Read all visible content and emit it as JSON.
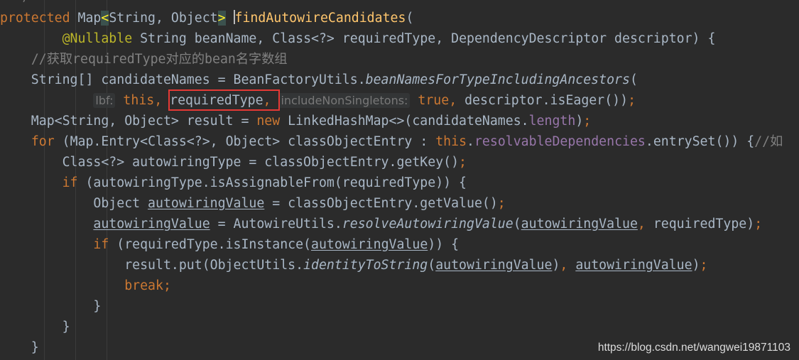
{
  "editor": {
    "top_fragment": "*/",
    "lines": [
      [
        {
          "t": "protected ",
          "c": "kw"
        },
        {
          "t": "Map",
          "c": ""
        },
        {
          "t": "<",
          "c": "brace-hl"
        },
        {
          "t": "String, Object",
          "c": ""
        },
        {
          "t": ">",
          "c": "brace-hl"
        },
        {
          "t": " ",
          "c": ""
        },
        {
          "t": "",
          "c": "caret"
        },
        {
          "t": "findAutowireCandidates",
          "c": "fn"
        },
        {
          "t": "(",
          "c": ""
        }
      ],
      [
        {
          "t": "        ",
          "c": ""
        },
        {
          "t": "@Nullable",
          "c": "ann"
        },
        {
          "t": " String beanName, Class<?> requiredType, DependencyDescriptor descriptor) {",
          "c": ""
        }
      ],
      [
        {
          "t": "    ",
          "c": ""
        },
        {
          "t": "//获取requiredType对应的bean名字数组",
          "c": "cmt"
        }
      ],
      [
        {
          "t": "    String[] candidateNames = BeanFactoryUtils.",
          "c": ""
        },
        {
          "t": "beanNamesForTypeIncludingAncestors",
          "c": "it"
        },
        {
          "t": "(",
          "c": ""
        }
      ],
      [
        {
          "t": "            ",
          "c": ""
        },
        {
          "t": "lbf:",
          "c": "hint"
        },
        {
          "t": " ",
          "c": ""
        },
        {
          "t": "this",
          "c": "kw"
        },
        {
          "t": ", ",
          "c": "kw"
        },
        {
          "t": "requiredType",
          "c": ""
        },
        {
          "t": ", ",
          "c": "kw"
        },
        {
          "t": "includeNonSingletons:",
          "c": "hint"
        },
        {
          "t": " ",
          "c": ""
        },
        {
          "t": "true",
          "c": "kw"
        },
        {
          "t": ", ",
          "c": "kw"
        },
        {
          "t": "descriptor.isEager())",
          "c": ""
        },
        {
          "t": ";",
          "c": "kw"
        }
      ],
      [
        {
          "t": "    Map<String, Object> result = ",
          "c": ""
        },
        {
          "t": "new ",
          "c": "kw"
        },
        {
          "t": "LinkedHashMap<>(candidateNames.",
          "c": ""
        },
        {
          "t": "length",
          "c": "fld"
        },
        {
          "t": ")",
          "c": ""
        },
        {
          "t": ";",
          "c": "kw"
        }
      ],
      [
        {
          "t": "    ",
          "c": ""
        },
        {
          "t": "for ",
          "c": "kw"
        },
        {
          "t": "(Map.Entry<Class<?>, Object> classObjectEntry : ",
          "c": ""
        },
        {
          "t": "this",
          "c": "kw"
        },
        {
          "t": ".",
          "c": ""
        },
        {
          "t": "resolvableDependencies",
          "c": "fld"
        },
        {
          "t": ".entrySet()) {",
          "c": ""
        },
        {
          "t": "//如",
          "c": "cmt"
        }
      ],
      [
        {
          "t": "        Class<?> autowiringType = classObjectEntry.getKey()",
          "c": ""
        },
        {
          "t": ";",
          "c": "kw"
        }
      ],
      [
        {
          "t": "        ",
          "c": ""
        },
        {
          "t": "if ",
          "c": "kw"
        },
        {
          "t": "(autowiringType.isAssignableFrom(requiredType)) {",
          "c": ""
        }
      ],
      [
        {
          "t": "            Object ",
          "c": ""
        },
        {
          "t": "autowiringValue",
          "c": "u"
        },
        {
          "t": " = classObjectEntry.getValue()",
          "c": ""
        },
        {
          "t": ";",
          "c": "kw"
        }
      ],
      [
        {
          "t": "            ",
          "c": ""
        },
        {
          "t": "autowiringValue",
          "c": "u"
        },
        {
          "t": " = AutowireUtils.",
          "c": ""
        },
        {
          "t": "resolveAutowiringValue",
          "c": "it"
        },
        {
          "t": "(",
          "c": ""
        },
        {
          "t": "autowiringValue",
          "c": "u"
        },
        {
          "t": ", ",
          "c": "kw"
        },
        {
          "t": "requiredType)",
          "c": ""
        },
        {
          "t": ";",
          "c": "kw"
        }
      ],
      [
        {
          "t": "            ",
          "c": ""
        },
        {
          "t": "if ",
          "c": "kw"
        },
        {
          "t": "(requiredType.isInstance(",
          "c": ""
        },
        {
          "t": "autowiringValue",
          "c": "u"
        },
        {
          "t": ")) {",
          "c": ""
        }
      ],
      [
        {
          "t": "                result.put(ObjectUtils.",
          "c": ""
        },
        {
          "t": "identityToString",
          "c": "it"
        },
        {
          "t": "(",
          "c": ""
        },
        {
          "t": "autowiringValue",
          "c": "u"
        },
        {
          "t": ")",
          "c": ""
        },
        {
          "t": ", ",
          "c": "kw"
        },
        {
          "t": "autowiringValue",
          "c": "u"
        },
        {
          "t": ")",
          "c": ""
        },
        {
          "t": ";",
          "c": "kw"
        }
      ],
      [
        {
          "t": "                ",
          "c": ""
        },
        {
          "t": "break;",
          "c": "kw"
        }
      ],
      [
        {
          "t": "            }",
          "c": ""
        }
      ],
      [
        {
          "t": "        }",
          "c": ""
        }
      ],
      [
        {
          "t": "    }",
          "c": ""
        }
      ]
    ]
  },
  "watermark": "https://blog.csdn.net/wangwei19871103",
  "colors": {
    "background": "#2b2b2b",
    "default_text": "#a9b7c6",
    "keyword": "#cc7832",
    "annotation": "#bbb529",
    "method_decl": "#ffc66d",
    "field": "#9876aa",
    "comment": "#808080",
    "highlight_box": "#e53935"
  }
}
